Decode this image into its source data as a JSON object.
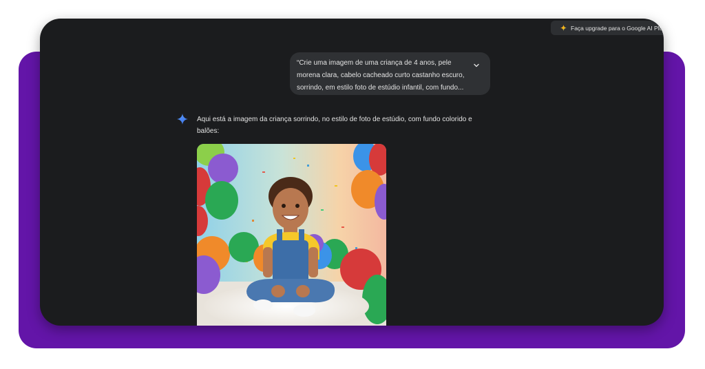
{
  "header": {
    "upgrade_label": "Faça upgrade para o Google AI Plus"
  },
  "prompt": {
    "lines": [
      "“Crie uma imagem de uma criança de 4 anos, pele",
      "morena clara, cabelo cacheado curto castanho escuro,",
      "sorrindo, em estilo foto de estúdio infantil, com fundo..."
    ]
  },
  "response": {
    "text": "Aqui está a imagem da criança sorrindo, no estilo de foto de estúdio, com fundo colorido e balões:"
  },
  "colors": {
    "frame_purple": "#6315a8",
    "window_dark": "#1b1c1e",
    "bubble": "#2f3134",
    "text": "#e3e3e3",
    "gem_blue": "#4c8df6"
  },
  "icons": {
    "expand": "chevron-down-icon",
    "assistant": "gemini-sparkle-icon",
    "upgrade": "sparkle-icon"
  }
}
